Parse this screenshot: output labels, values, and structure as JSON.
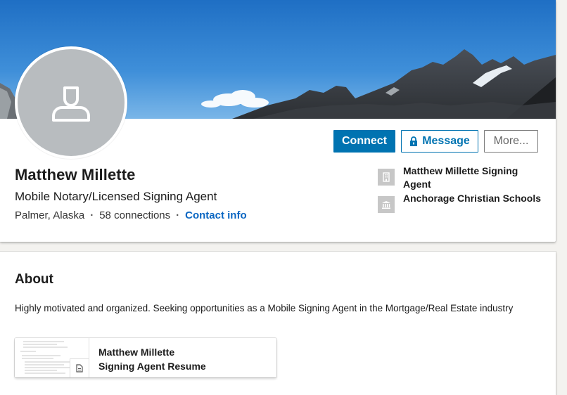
{
  "profile": {
    "name": "Matthew Millette",
    "headline": "Mobile Notary/Licensed Signing Agent",
    "location": "Palmer, Alaska",
    "connections": "58 connections",
    "contact_info": "Contact info",
    "separator": "·"
  },
  "actions": {
    "connect": "Connect",
    "message": "Message",
    "more": "More..."
  },
  "positions": [
    {
      "label": "Matthew Millette Signing Agent",
      "icon": "building-icon"
    },
    {
      "label": "Anchorage Christian Schools",
      "icon": "school-icon"
    }
  ],
  "about": {
    "title": "About",
    "text": "Highly motivated and organized. Seeking opportunities as a Mobile Signing Agent in the Mortgage/Real Estate industry",
    "media": {
      "line1": "Matthew Millette",
      "line2": "Signing Agent Resume",
      "icon": "document-icon"
    }
  },
  "colors": {
    "brand": "#0073b1",
    "link": "#0a66c2",
    "avatar_bg": "#b8bcbf",
    "page_bg": "#f3f2ef"
  }
}
